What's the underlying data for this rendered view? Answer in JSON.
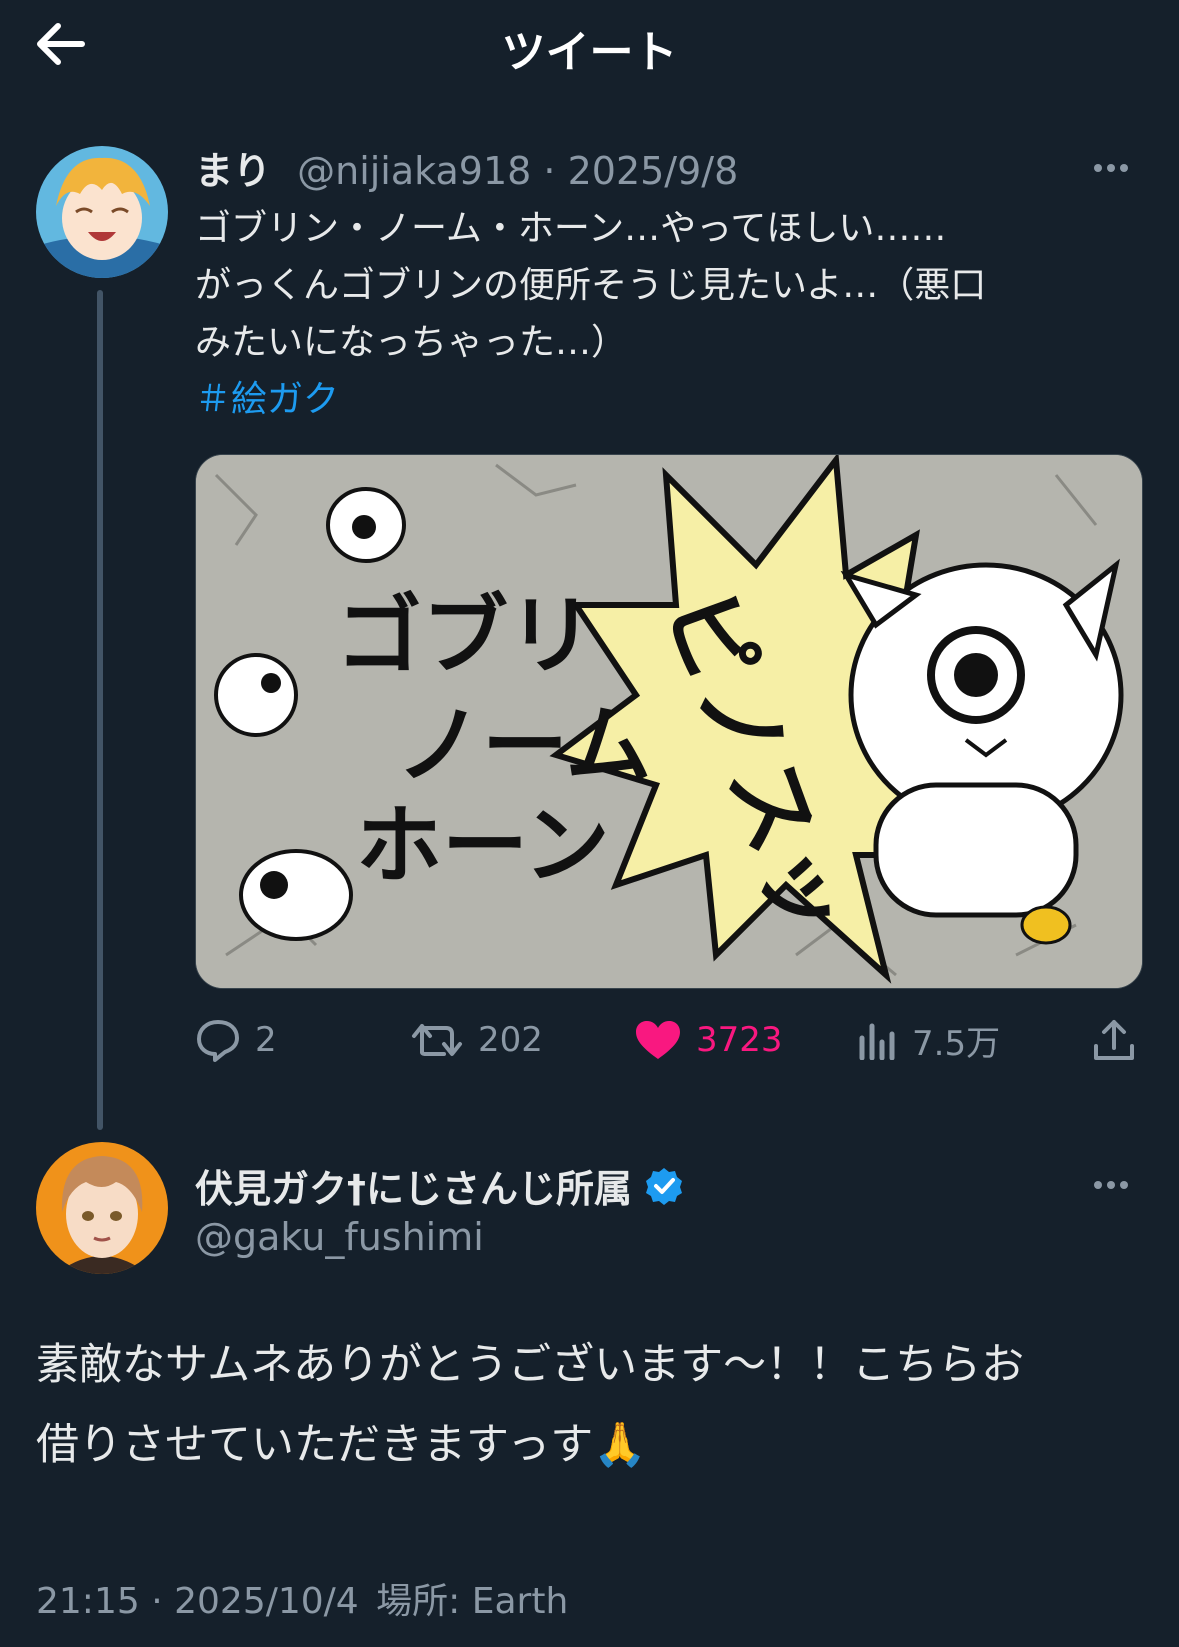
{
  "header": {
    "title": "ツイート",
    "back_icon": "arrow-left-icon"
  },
  "quoted_tweet": {
    "display_name": "まり",
    "handle": "@nijiaka918",
    "separator": "·",
    "date": "2025/9/8",
    "text_lines": [
      "ゴブリン・ノーム・ホーン…やってほしい……",
      "がっくんゴブリンの便所そうじ見たいよ…（悪口",
      "みたいになっちゃった…）"
    ],
    "hashtag": "＃絵ガク",
    "image": {
      "lettering": [
        "ゴブリ",
        "ノーム",
        "ホーン",
        "ピノスッ"
      ]
    },
    "actions": {
      "reply_count": "2",
      "retweet_count": "202",
      "like_count": "3723",
      "view_count": "7.5万"
    },
    "colors": {
      "like": "#f91880",
      "link": "#1d9bf0"
    }
  },
  "reply_tweet": {
    "display_name": "伏見ガク†にじさんじ所属",
    "verified_icon": "verified-badge-icon",
    "handle": "@gaku_fushimi",
    "text_line1": "素敵なサムネありがとうございます〜！！こちらお",
    "text_line2": "借りさせていただきますっす",
    "emoji": "🙏",
    "time": "21:15",
    "separator": "·",
    "date": "2025/10/4",
    "location_label": "場所:",
    "location": "Earth"
  }
}
